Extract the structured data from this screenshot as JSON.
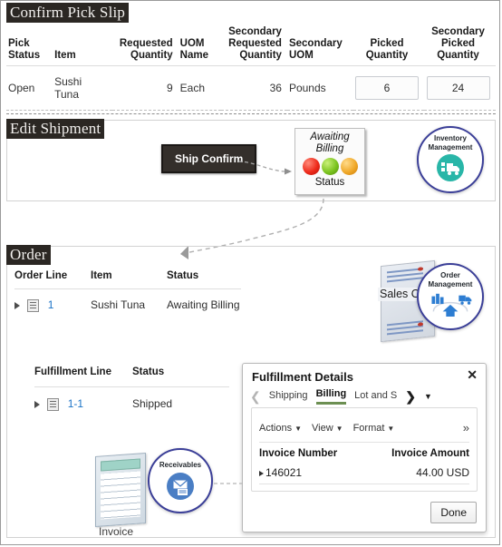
{
  "sections": {
    "pick_slip": {
      "title": "Confirm Pick Slip",
      "columns": [
        "Pick Status",
        "Item",
        "Requested Quantity",
        "UOM Name",
        "Secondary Requested Quantity",
        "Secondary UOM",
        "Picked Quantity",
        "Secondary Picked Quantity"
      ],
      "row": {
        "pick_status": "Open",
        "item": "Sushi Tuna",
        "requested_quantity": "9",
        "uom_name": "Each",
        "secondary_requested_quantity": "36",
        "secondary_uom": "Pounds",
        "picked_quantity": "6",
        "secondary_picked_quantity": "24"
      }
    },
    "edit_shipment": {
      "title": "Edit Shipment",
      "ship_confirm_button": "Ship Confirm",
      "status_card": {
        "heading_line1": "Awaiting",
        "heading_line2": "Billing",
        "caption": "Status",
        "lights": [
          "#ee2b1b",
          "#7cc420",
          "#f0a92a"
        ]
      },
      "badge": {
        "label_line1": "Inventory",
        "label_line2": "Management",
        "icon": "truck-warehouse-icon",
        "accent": "#29b6a8",
        "ring": "#3b3f98"
      }
    },
    "order": {
      "title": "Order",
      "columns": [
        "Order Line",
        "Item",
        "Status"
      ],
      "row": {
        "expand_icon": "expand-triangle-icon",
        "detail_icon": "row-detail-icon",
        "order_line": "1",
        "item": "Sushi Tuna",
        "status": "Awaiting Billing"
      },
      "fulfillment": {
        "columns": [
          "Fulfillment Line",
          "Status"
        ],
        "row": {
          "expand_icon": "expand-triangle-icon",
          "detail_icon": "row-detail-icon",
          "fulfillment_line": "1-1",
          "status": "Shipped"
        }
      },
      "sales_order_doc": "Sales Order",
      "badge": {
        "label_line1": "Order",
        "label_line2": "Management",
        "icon": "supply-chain-icon",
        "ring": "#3b3f98"
      }
    },
    "fulfillment_details": {
      "title": "Fulfillment Details",
      "close_icon": "close-icon",
      "prev_icon": "chevron-left-icon",
      "next_icon": "chevron-right-icon",
      "overflow_icon": "caret-down-icon",
      "tabs": [
        {
          "label": "Shipping",
          "active": false
        },
        {
          "label": "Billing",
          "active": true
        },
        {
          "label": "Lot and S",
          "active": false
        }
      ],
      "toolbar": [
        {
          "label": "Actions"
        },
        {
          "label": "View"
        },
        {
          "label": "Format"
        }
      ],
      "toolbar_more_icon": "double-chevron-right-icon",
      "table": {
        "columns": [
          "Invoice Number",
          "Invoice Amount"
        ],
        "row": {
          "invoice_number": "146021",
          "invoice_amount": "44.00 USD"
        }
      },
      "done_button": "Done"
    },
    "receivables": {
      "invoice_label": "Invoice",
      "badge": {
        "label": "Receivables",
        "icon": "envelope-icon",
        "accent": "#4a7ec4",
        "ring": "#3b3f98"
      }
    }
  }
}
